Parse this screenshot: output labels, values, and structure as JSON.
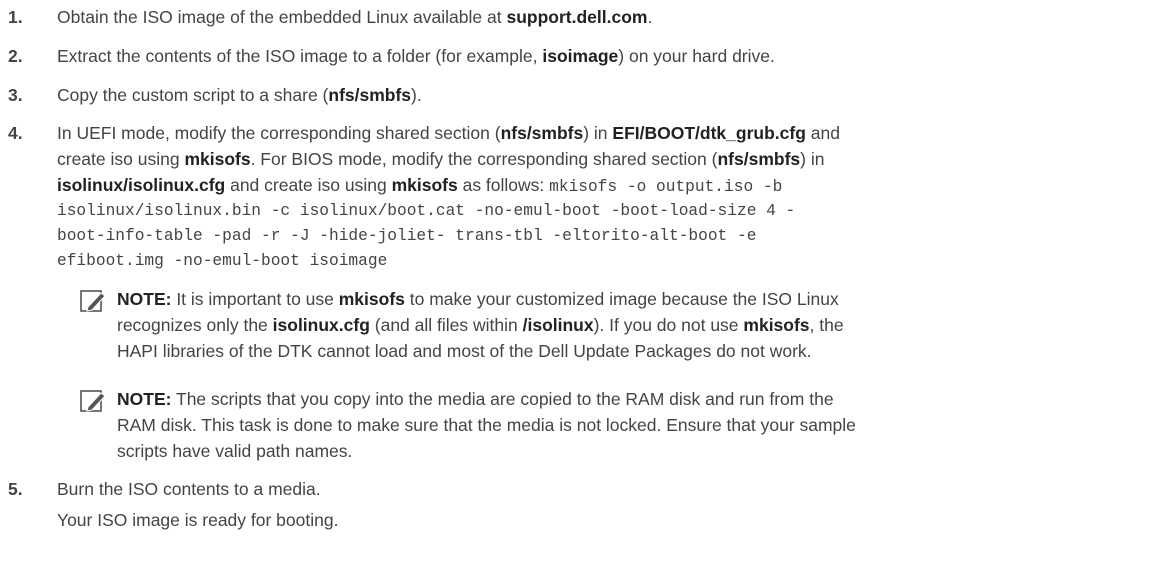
{
  "steps": [
    {
      "number": "1.",
      "pre": "Obtain the ISO image of the embedded Linux available at ",
      "b1": "support.dell.com",
      "post": "."
    },
    {
      "number": "2.",
      "pre": "Extract the contents of the ISO image to a folder (for example, ",
      "b1": "isoimage",
      "post": ") on your hard drive."
    },
    {
      "number": "3.",
      "pre": "Copy the custom script to a share (",
      "b1": "nfs/smbfs",
      "post": ")."
    },
    {
      "number": "4.",
      "l1_a": "In UEFI mode, modify the corresponding shared section (",
      "l1_b": "nfs/smbfs",
      "l1_c": ") in ",
      "l1_d": "EFI/BOOT/dtk_grub.cfg",
      "l1_e": " and",
      "l2_a": "create iso using ",
      "l2_b": "mkisofs",
      "l2_c": ". For BIOS mode, modify the corresponding shared section (",
      "l2_d": "nfs/smbfs",
      "l2_e": ") in",
      "l3_a": "isolinux/isolinux.cfg",
      "l3_b": " and create iso using ",
      "l3_c": "mkisofs",
      "l3_d": " as follows: ",
      "l3_code": "mkisofs -o output.iso -b",
      "l4_code": "isolinux/isolinux.bin -c isolinux/boot.cat -no-emul-boot -boot-load-size 4 -",
      "l5_code": "boot-info-table -pad -r -J -hide-joliet- trans-tbl -eltorito-alt-boot -e",
      "l6_code": "efiboot.img -no-emul-boot isoimage"
    },
    {
      "number": "5.",
      "text": "Burn the ISO contents to a media.",
      "result": "Your ISO image is ready for booting."
    }
  ],
  "notes": [
    {
      "label": "NOTE:",
      "l1_a": " It is important to use ",
      "l1_b": "mkisofs",
      "l1_c": " to make your customized image because the ISO Linux",
      "l2_a": "recognizes only the ",
      "l2_b": "isolinux.cfg",
      "l2_c": " (and all files within ",
      "l2_d": "/isolinux",
      "l2_e": "). If you do not use ",
      "l2_f": "mkisofs",
      "l2_g": ", the",
      "l3": "HAPI libraries of the DTK cannot load and most of the Dell Update Packages do not work."
    },
    {
      "label": "NOTE:",
      "l1": " The scripts that you copy into the media are copied to the RAM disk and run from the",
      "l2": "RAM disk. This task is done to make sure that the media is not locked. Ensure that your sample",
      "l3": "scripts have valid path names."
    }
  ],
  "icons": {
    "note": "pencil-note-icon"
  },
  "colors": {
    "text": "#444444",
    "bold": "#222222"
  }
}
